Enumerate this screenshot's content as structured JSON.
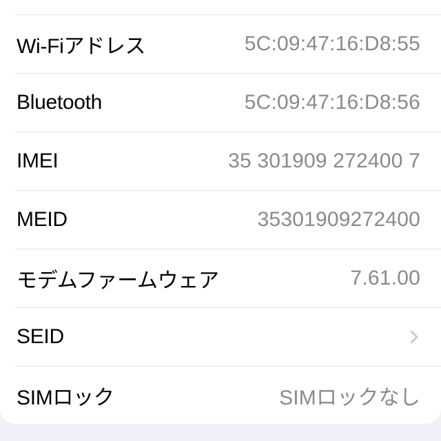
{
  "rows": [
    {
      "label": "Wi-Fiアドレス",
      "value": "5C:09:47:16:D8:55"
    },
    {
      "label": "Bluetooth",
      "value": "5C:09:47:16:D8:56"
    },
    {
      "label": "IMEI",
      "value": "35 301909 272400 7"
    },
    {
      "label": "MEID",
      "value": "35301909272400"
    },
    {
      "label": "モデムファームウェア",
      "value": "7.61.00"
    },
    {
      "label": "SEID",
      "icon": "chevron-right-icon"
    },
    {
      "label": "SIMロック",
      "value": "SIMロックなし"
    }
  ],
  "colors": {
    "label": "#000000",
    "value": "#8a8a8e",
    "separator": "#e2e2e6",
    "background": "#f1f0f6",
    "card": "#ffffff",
    "chevron": "#c4c4c7"
  }
}
